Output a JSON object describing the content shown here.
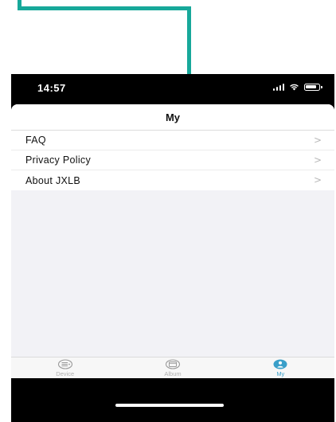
{
  "status_bar": {
    "time": "14:57"
  },
  "nav": {
    "title": "My"
  },
  "menu": {
    "items": [
      {
        "label": "FAQ",
        "chevron": ">"
      },
      {
        "label": "Privacy Policy",
        "chevron": ">"
      },
      {
        "label": "About JXLB",
        "chevron": ">"
      }
    ]
  },
  "tabs": {
    "items": [
      {
        "label": "Device",
        "icon": "device-icon",
        "active": false
      },
      {
        "label": "Album",
        "icon": "album-icon",
        "active": false
      },
      {
        "label": "My",
        "icon": "user-icon",
        "active": true
      }
    ]
  },
  "colors": {
    "annotation": "#17a89a",
    "active_tab": "#3a9fc9",
    "inactive_tab": "#b0b0b0",
    "background": "#f2f2f6"
  }
}
